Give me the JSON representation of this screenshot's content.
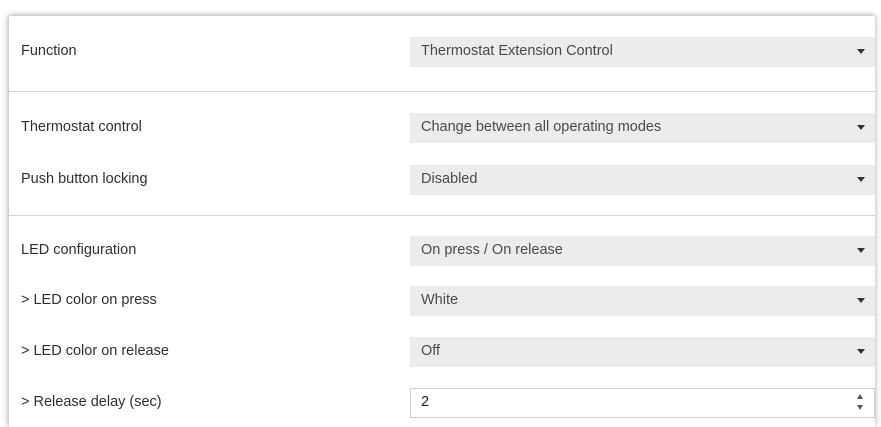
{
  "rows": [
    {
      "label": "Function",
      "value": "Thermostat Extension Control"
    },
    {
      "label": "Thermostat control",
      "value": "Change between all operating modes"
    },
    {
      "label": "Push button locking",
      "value": "Disabled"
    },
    {
      "label": "LED configuration",
      "value": "On press / On release"
    },
    {
      "label": "> LED color on press",
      "value": "White"
    },
    {
      "label": "> LED color on release",
      "value": "Off"
    },
    {
      "label": "> Release delay (sec)",
      "value": "2"
    }
  ],
  "colors": {
    "control_bg": "#ececec",
    "label_text": "#2f2f2f",
    "divider": "#d6d6d6"
  },
  "icons": {
    "dropdown": "chevron-down-icon",
    "stepper": "spin-arrows-icon"
  }
}
